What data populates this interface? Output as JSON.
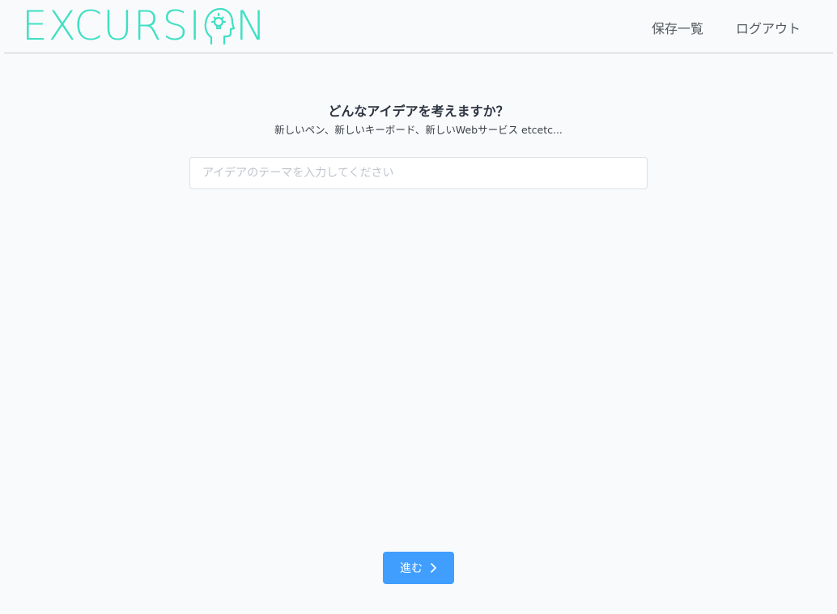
{
  "header": {
    "logo": {
      "text_before": "EXCURSI",
      "text_after": "N",
      "icon": "head-lightbulb-icon",
      "color": "#3fe0c4"
    },
    "nav": {
      "saved_list_label": "保存一覧",
      "logout_label": "ログアウト"
    }
  },
  "main": {
    "title": "どんなアイデアを考えますか？",
    "hint": "新しいペン、新しいキーボード、新しいWebサービス etcetc...",
    "theme_input": {
      "value": "",
      "placeholder": "アイデアのテーマを入力してください"
    }
  },
  "footer": {
    "next_button_label": "進む",
    "next_button_icon": "chevron-right-icon",
    "next_button_color": "#409eff"
  }
}
